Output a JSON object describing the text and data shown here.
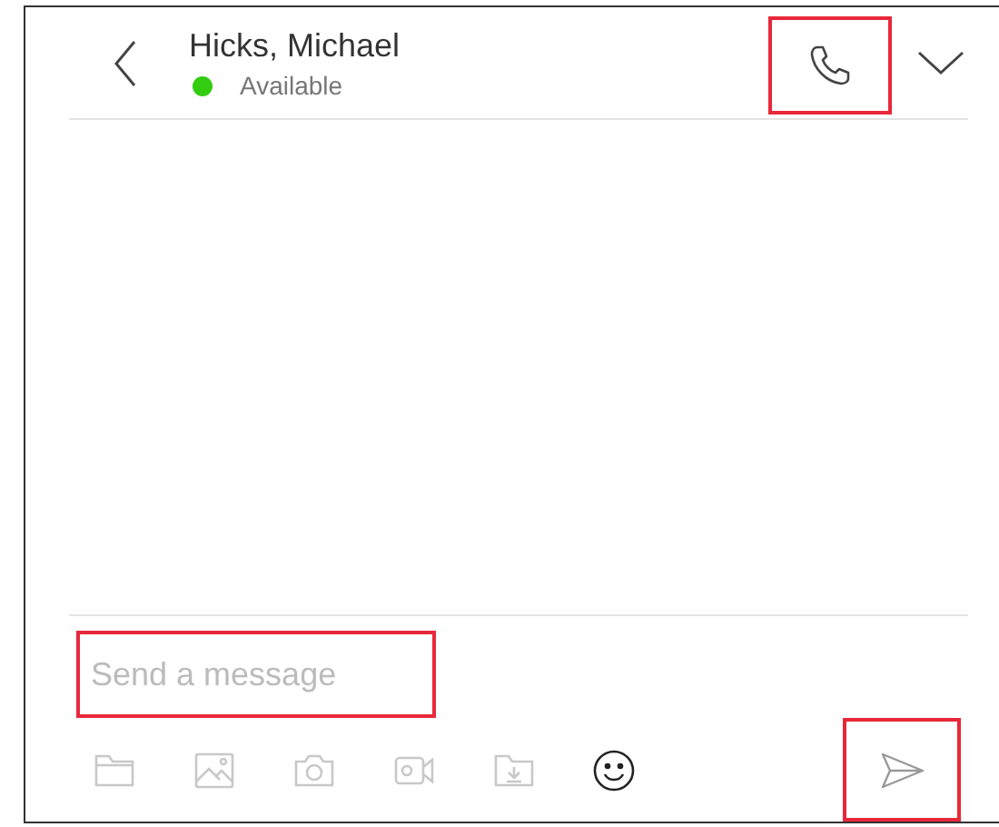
{
  "header": {
    "name": "Hicks, Michael",
    "status": {
      "label": "Available",
      "color": "#33cc11"
    },
    "call_button": {
      "highlighted": true
    }
  },
  "composer": {
    "placeholder": "Send a message",
    "highlighted": true
  },
  "tools": [
    {
      "kind": "folder",
      "disabled": true
    },
    {
      "kind": "image",
      "disabled": true
    },
    {
      "kind": "camera",
      "disabled": true
    },
    {
      "kind": "video",
      "disabled": true
    },
    {
      "kind": "folder-download",
      "disabled": true
    },
    {
      "kind": "emoji",
      "disabled": false
    }
  ],
  "send_button": {
    "highlighted": true,
    "disabled": true
  }
}
